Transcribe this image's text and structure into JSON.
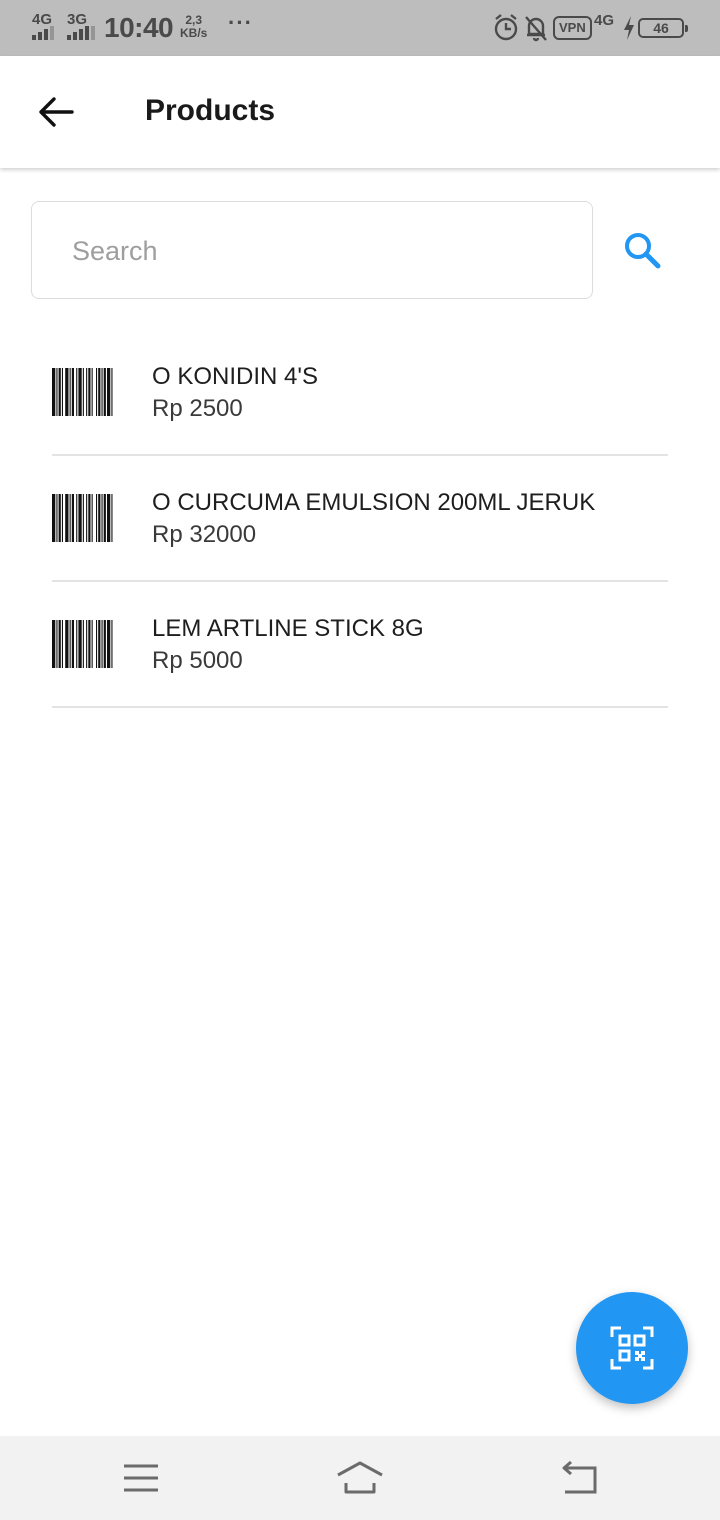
{
  "status_bar": {
    "net1": "4G",
    "net2": "3G",
    "time": "10:40",
    "speed_value": "2,3",
    "speed_unit": "KB/s",
    "more": "···",
    "vpn": "VPN",
    "net3": "4G",
    "battery": "46",
    "icons": [
      "alarm-icon",
      "bell-off-icon",
      "charging-icon"
    ]
  },
  "app_bar": {
    "title": "Products",
    "back_icon": "arrow-left-icon"
  },
  "search": {
    "placeholder": "Search",
    "value": "",
    "icon": "search-icon",
    "accent": "#2196f3"
  },
  "products": [
    {
      "name": "O KONIDIN 4'S",
      "price": "Rp 2500",
      "icon": "barcode-icon"
    },
    {
      "name": "O CURCUMA EMULSION 200ML JERUK",
      "price": "Rp 32000",
      "icon": "barcode-icon"
    },
    {
      "name": "LEM ARTLINE STICK 8G",
      "price": "Rp 5000",
      "icon": "barcode-icon"
    }
  ],
  "fab": {
    "icon": "qr-scan-icon",
    "color": "#2196f3"
  },
  "nav_bar": {
    "icons": [
      "menu-icon",
      "home-icon",
      "back-nav-icon"
    ]
  }
}
